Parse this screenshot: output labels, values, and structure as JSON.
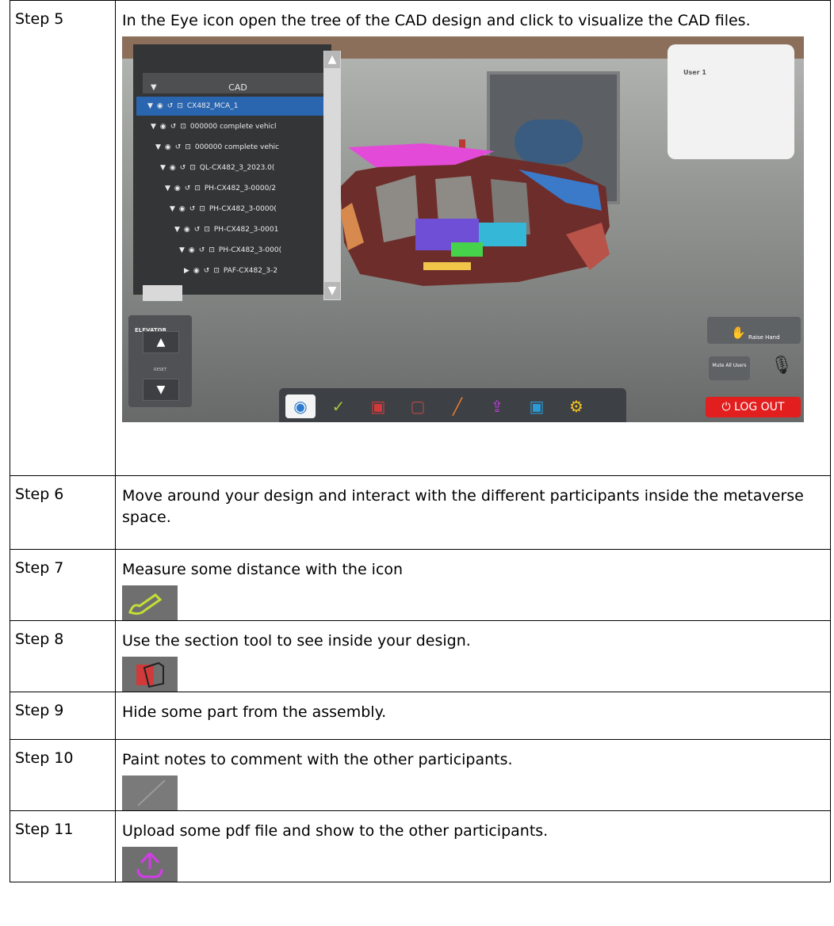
{
  "rows": [
    {
      "label": "Step 5",
      "text": "In the Eye icon open the tree of the CAD design and click to visualize the CAD files."
    },
    {
      "label": "Step 6",
      "text": "Move around your design and interact with the different participants inside the metaverse space."
    },
    {
      "label": "Step 7",
      "text": "Measure some distance with the icon"
    },
    {
      "label": "Step 8",
      "text": "Use the section tool to see inside your design."
    },
    {
      "label": "Step 9",
      "text": "Hide some part from the assembly."
    },
    {
      "label": "Step 10",
      "text": "Paint notes to comment with the other participants."
    },
    {
      "label": "Step 11",
      "text": "Upload some pdf file and show to the other participants."
    }
  ],
  "screenshot": {
    "tree_header": "CAD",
    "tree_items": [
      "CX482_MCA_1",
      "000000 complete vehicl",
      "000000 complete vehic",
      "QL-CX482_3_2023.0(",
      "PH-CX482_3-0000/2",
      "PH-CX482_3-0000(",
      "PH-CX482_3-0001",
      "PH-CX482_3-000(",
      "PAF-CX482_3-2"
    ],
    "user_box_label": "User 1",
    "elevator_label": "ELEVATOR",
    "reset_label": "RESET",
    "raise_hand_label": "Raise Hand",
    "mute_all_label": "Mute All Users",
    "logout_label": "LOG OUT",
    "colors": {
      "logout": "#e21e1e",
      "tree_selected": "#2a65b0",
      "toolbar": "#3d4045"
    }
  }
}
